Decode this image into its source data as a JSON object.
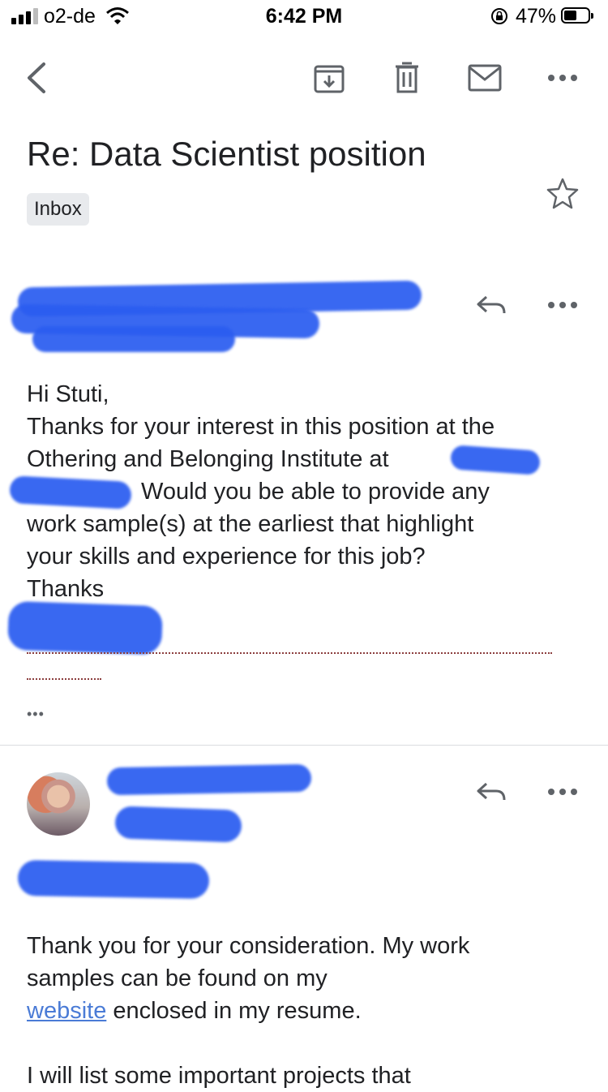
{
  "status_bar": {
    "carrier": "o2-de",
    "time": "6:42 PM",
    "battery": "47%",
    "battery_level": 0.47,
    "icons": [
      "signal-icon",
      "wifi-icon",
      "rotation-lock-icon",
      "battery-icon"
    ]
  },
  "toolbar": {
    "icons": [
      "back-arrow-icon",
      "archive-icon",
      "trash-icon",
      "mail-icon",
      "more-icon"
    ]
  },
  "email": {
    "subject": "Re: Data Scientist position",
    "label": "Inbox"
  },
  "message1": {
    "greeting": "Hi Stuti,",
    "line1": "Thanks for your interest in this position at the",
    "line2": "Othering and Belonging Institute at",
    "line3": "Would you be able to provide any",
    "line4": "work sample(s) at the earliest that highlight",
    "line5": "your skills and experience for this job?",
    "line6": "Thanks",
    "dots": "•••"
  },
  "message2": {
    "line1": "Thank you for your consideration. My work",
    "line2": "samples can be found on my",
    "link": "website",
    "line3_rest": " enclosed in my resume.",
    "line4": "I will list some important projects that"
  },
  "colors": {
    "redaction": "#2b5df0",
    "link": "#4a7bd6",
    "chip_bg": "#e8eaed",
    "icon_gray": "#5f6368"
  }
}
